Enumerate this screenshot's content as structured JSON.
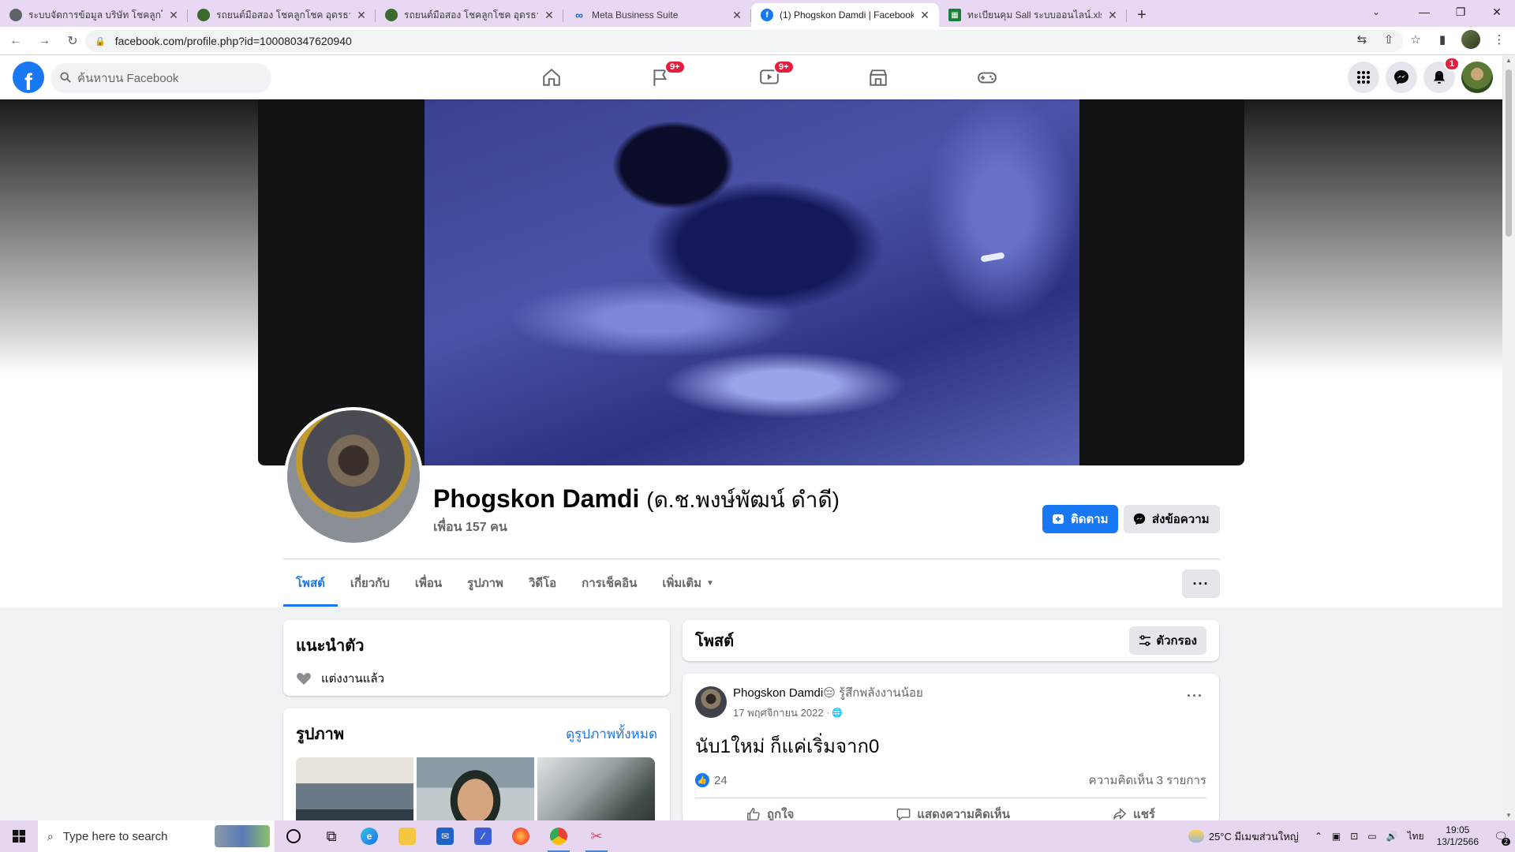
{
  "browser": {
    "tabs": [
      {
        "title": "ระบบจัดการข้อมูล บริษัท โชคลูกโชค อ",
        "icon": "globe-icon",
        "icon_color": "#5f6368",
        "active": false
      },
      {
        "title": "รถยนต์มือสอง โชคลูกโชค อุดรธานี",
        "icon": "site-icon",
        "icon_color": "#3a6b2a",
        "active": false
      },
      {
        "title": "รถยนต์มือสอง โชคลูกโชค อุดรธานี",
        "icon": "site-icon",
        "icon_color": "#3a6b2a",
        "active": false
      },
      {
        "title": "Meta Business Suite",
        "icon": "meta-icon",
        "icon_color": "#0668e1",
        "active": false
      },
      {
        "title": "(1) Phogskon Damdi | Facebook",
        "icon": "facebook-icon",
        "icon_color": "#1877f2",
        "active": true
      },
      {
        "title": "ทะเบียนคุม Sall ระบบออนไลน์.xlsx - G",
        "icon": "sheets-icon",
        "icon_color": "#188038",
        "active": false
      }
    ],
    "url": "facebook.com/profile.php?id=100080347620940"
  },
  "fb": {
    "search_placeholder": "ค้นหาบน Facebook",
    "nav_badges": {
      "groups": "9+",
      "watch": "9+"
    },
    "notification_badge": "1",
    "brand_color": "#1877f2",
    "badge_color": "#e41e3f"
  },
  "profile": {
    "name": "Phogskon Damdi",
    "alt_name": "(ด.ช.พงษ์พัฒน์ ดำดี)",
    "friends": "เพื่อน 157 คน",
    "follow_label": "ติดตาม",
    "message_label": "ส่งข้อความ",
    "tabs": [
      {
        "label": "โพสต์",
        "active": true
      },
      {
        "label": "เกี่ยวกับ",
        "active": false
      },
      {
        "label": "เพื่อน",
        "active": false
      },
      {
        "label": "รูปภาพ",
        "active": false
      },
      {
        "label": "วิดีโอ",
        "active": false
      },
      {
        "label": "การเช็คอิน",
        "active": false
      },
      {
        "label": "เพิ่มเติม",
        "active": false,
        "dropdown": true
      }
    ]
  },
  "intro": {
    "title": "แนะนำตัว",
    "relationship": "แต่งงานแล้ว"
  },
  "photos": {
    "title": "รูปภาพ",
    "see_all": "ดูรูปภาพทั้งหมด"
  },
  "posts": {
    "title": "โพสต์",
    "filter_label": "ตัวกรอง",
    "items": [
      {
        "author": "Phogskon Damdi",
        "feeling": "😔 รู้สึกพลังงานน้อย",
        "date": "17 พฤศจิกายน 2022",
        "text": "นับ1ใหม่ ก็แค่เริ่มจาก0",
        "likes": "24",
        "comments": "ความคิดเห็น 3 รายการ",
        "actions": {
          "like": "ถูกใจ",
          "comment": "แสดงความคิดเห็น",
          "share": "แชร์"
        }
      }
    ]
  },
  "taskbar": {
    "search_placeholder": "Type here to search",
    "weather": "25°C  มีเมฆส่วนใหญ่",
    "language": "ไทย",
    "time": "19:05",
    "date": "13/1/2566",
    "notification_count": "2"
  }
}
